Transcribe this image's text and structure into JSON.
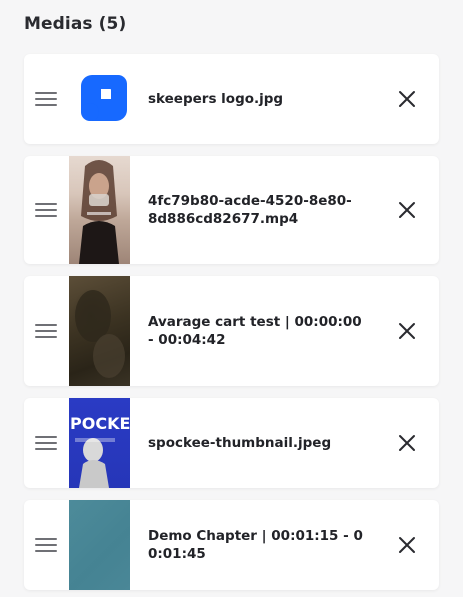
{
  "header": {
    "title": "Medias (5)"
  },
  "medias": [
    {
      "name": "skeepers logo.jpg",
      "thumbnail_icon": "skeepers-logo-icon",
      "thumbnail_color": "#1769ff"
    },
    {
      "name": "4fc79b80-acde-4520-8e80-8d886cd82677.mp4",
      "thumbnail_icon": "video-thumbnail-woman"
    },
    {
      "name": "Avarage cart test | 00:00:00 - 00:04:42",
      "thumbnail_icon": "video-thumbnail-dark"
    },
    {
      "name": "spockee-thumbnail.jpeg",
      "thumbnail_icon": "poster-thumbnail",
      "thumbnail_text": "POCKE"
    },
    {
      "name": "Demo Chapter | 00:01:15 - 0 0:01:45",
      "thumbnail_icon": "teal-thumbnail"
    }
  ],
  "icons": {
    "drag": "drag-handle-icon",
    "remove": "close-icon"
  }
}
